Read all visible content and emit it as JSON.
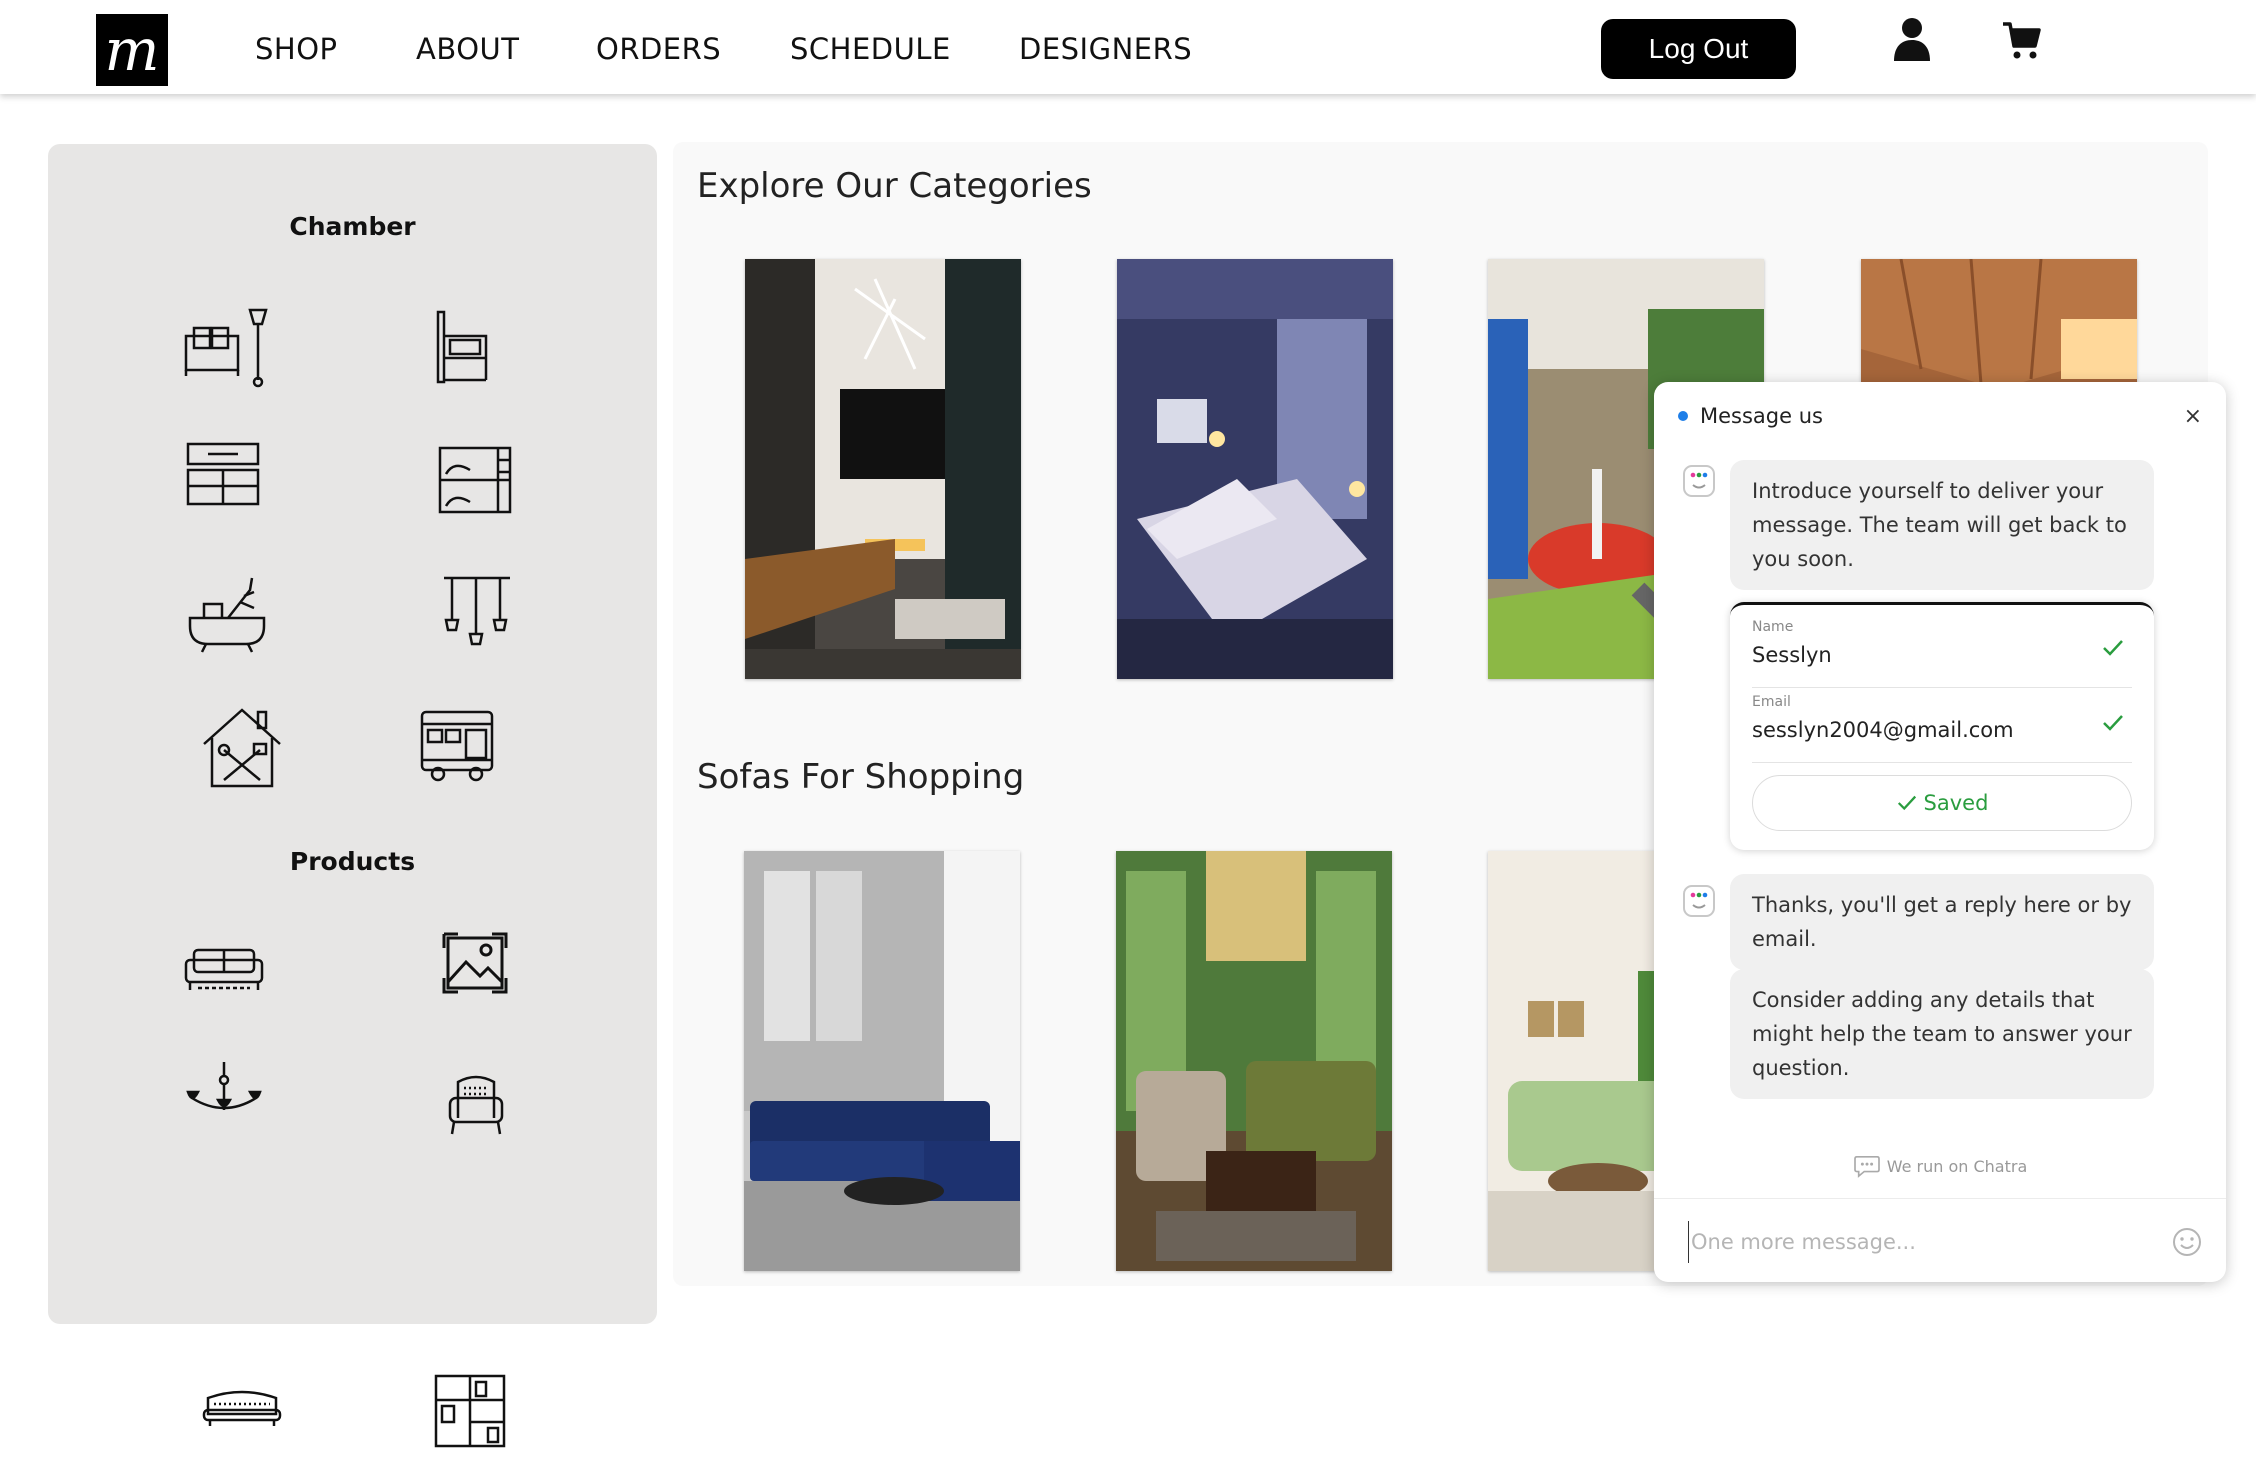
{
  "header": {
    "logo_letter": "m",
    "nav": [
      "SHOP",
      "ABOUT",
      "ORDERS",
      "SCHEDULE",
      "DESIGNERS"
    ],
    "logout_label": "Log Out",
    "icons": [
      "user-icon",
      "cart-icon"
    ]
  },
  "sidebar": {
    "chamber_heading": "Chamber",
    "chamber_icons": [
      "living-room-icon",
      "bedroom-icon",
      "office-icon",
      "kids-room-icon",
      "bathroom-icon",
      "lighting-icon",
      "home-repair-icon",
      "outdoor-icon"
    ],
    "products_heading": "Products",
    "products_icons": [
      "sofa-icon",
      "wall-art-icon",
      "chandelier-icon",
      "armchair-icon",
      "loveseat-icon",
      "storage-icon"
    ]
  },
  "main": {
    "categories_title": "Explore Our Categories",
    "sofas_title": "Sofas For Shopping",
    "category_images": [
      "living-room-photo",
      "bedroom-photo",
      "kids-play-area-photo",
      "wooden-ceiling-room-photo"
    ],
    "sofa_images": [
      "blue-sectional-sofa-photo",
      "green-sofa-living-room-photo",
      "mint-sofa-photo"
    ]
  },
  "chat": {
    "title": "Message us",
    "close_label": "×",
    "intro_message": "Introduce yourself to deliver your message. The team will get back to you soon.",
    "name_label": "Name",
    "name_value": "Sesslyn",
    "email_label": "Email",
    "email_value": "sesslyn2004@gmail.com",
    "saved_label": "Saved",
    "reply_message": "Thanks, you'll get a reply here or by email.",
    "details_message": "Consider adding any details that might help the team to answer your question.",
    "powered_by": "We run on Chatra",
    "input_placeholder": "One more message...",
    "accent_color": "#1e7ee8",
    "saved_color": "#2a9d3f"
  }
}
